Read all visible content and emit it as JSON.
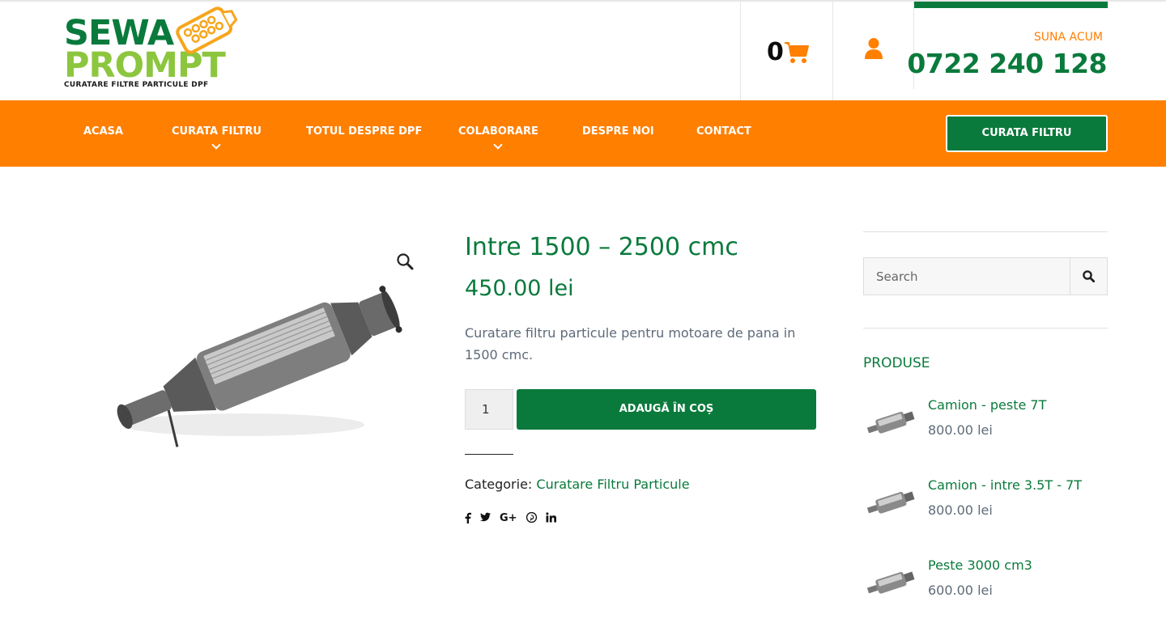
{
  "brand": {
    "line1": "SEWA",
    "line2": "PROMPT",
    "tagline": "CURATARE FILTRE PARTICULE DPF",
    "logo_icon": "filter-grid-icon",
    "green": "#0a7a3c",
    "orange": "#ff7f00",
    "lime": "#8cc63f"
  },
  "header": {
    "cart_count": "0",
    "cart_icon": "shopping-cart-icon",
    "user_icon": "user-icon",
    "call_label": "SUNA ACUM",
    "phone": "0722 240 128"
  },
  "nav": {
    "items": [
      {
        "label": "ACASA"
      },
      {
        "label": "CURATA FILTRU",
        "has_dropdown": true
      },
      {
        "label": "TOTUL DESPRE DPF"
      },
      {
        "label": "COLABORARE",
        "has_dropdown": true
      },
      {
        "label": "DESPRE NOI"
      },
      {
        "label": "CONTACT"
      }
    ],
    "cta_label": "CURATA FILTRU"
  },
  "product": {
    "title": "Intre 1500 – 2500 cmc",
    "price": "450.00 lei",
    "description": "Curatare filtru particule pentru motoare de pana in 1500 cmc.",
    "quantity": "1",
    "add_to_cart": "ADAUGĂ ÎN COȘ",
    "category_label": "Categorie:",
    "category": "Curatare Filtru Particule",
    "image_icon": "diesel-particulate-filter-image",
    "zoom_icon": "magnifier-icon"
  },
  "share": [
    "facebook-icon",
    "twitter-icon",
    "google-plus-icon",
    "pinterest-icon",
    "linkedin-icon"
  ],
  "sidebar": {
    "search_placeholder": "Search",
    "products_title": "PRODUSE",
    "products": [
      {
        "name": "Camion - peste 7T",
        "price": "800.00 lei"
      },
      {
        "name": "Camion - intre 3.5T - 7T",
        "price": "800.00 lei"
      },
      {
        "name": "Peste 3000 cm3",
        "price": "600.00 lei"
      }
    ]
  }
}
